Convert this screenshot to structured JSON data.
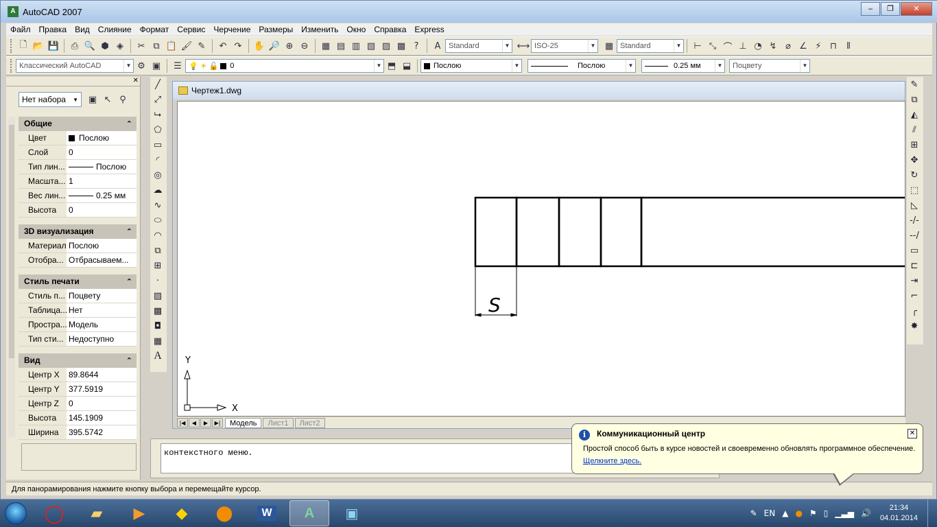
{
  "window": {
    "title": "AutoCAD 2007",
    "app_icon": "A"
  },
  "menu": [
    "Файл",
    "Правка",
    "Вид",
    "Слияние",
    "Формат",
    "Сервис",
    "Черчение",
    "Размеры",
    "Изменить",
    "Окно",
    "Справка",
    "Express"
  ],
  "toolbar1": {
    "text_style": "Standard",
    "dim_style": "ISO-25",
    "table_style": "Standard"
  },
  "toolbar2": {
    "workspace": "Классический AutoCAD",
    "layer": "0",
    "color": "Послою",
    "linetype": "Послою",
    "lineweight": "0.25 мм",
    "plotstyle": "Поцвету"
  },
  "properties": {
    "selection": "Нет набора",
    "sections": [
      {
        "title": "Общие",
        "rows": [
          {
            "key": "Цвет",
            "value": "Послою",
            "marker": "swatch"
          },
          {
            "key": "Слой",
            "value": "0"
          },
          {
            "key": "Тип лин...",
            "value": "Послою",
            "marker": "line"
          },
          {
            "key": "Масшта...",
            "value": "1"
          },
          {
            "key": "Вес лин...",
            "value": "0.25 мм",
            "marker": "line"
          },
          {
            "key": "Высота",
            "value": "0"
          }
        ]
      },
      {
        "title": "3D визуализация",
        "rows": [
          {
            "key": "Материал",
            "value": "Послою"
          },
          {
            "key": "Отобра...",
            "value": "Отбрасываем..."
          }
        ]
      },
      {
        "title": "Стиль печати",
        "rows": [
          {
            "key": "Стиль п...",
            "value": "Поцвету"
          },
          {
            "key": "Таблица...",
            "value": "Нет"
          },
          {
            "key": "Простра...",
            "value": "Модель"
          },
          {
            "key": "Тип сти...",
            "value": "Недоступно"
          }
        ]
      },
      {
        "title": "Вид",
        "rows": [
          {
            "key": "Центр X",
            "value": "89.8644"
          },
          {
            "key": "Центр Y",
            "value": "377.5919"
          },
          {
            "key": "Центр Z",
            "value": "0"
          },
          {
            "key": "Высота",
            "value": "145.1909"
          },
          {
            "key": "Ширина",
            "value": "395.5742"
          }
        ]
      }
    ]
  },
  "document": {
    "title": "Чертеж1.dwg",
    "dimension_label": "S",
    "ucs_x": "X",
    "ucs_y": "Y",
    "tabs": [
      "Модель",
      "Лист1",
      "Лист2"
    ]
  },
  "command_line": {
    "text": "контекстного меню."
  },
  "status_bar": {
    "text": "Для панорамирования нажмите кнопку выбора и перемещайте курсор."
  },
  "balloon": {
    "title": "Коммуникационный центр",
    "body": "Простой способ быть в курсе новостей и своевременно обновлять программное обеспечение.",
    "link": "Щелкните здесь."
  },
  "taskbar": {
    "lang": "EN",
    "time": "21:34",
    "date": "04.01.2014",
    "word_label": "W"
  }
}
